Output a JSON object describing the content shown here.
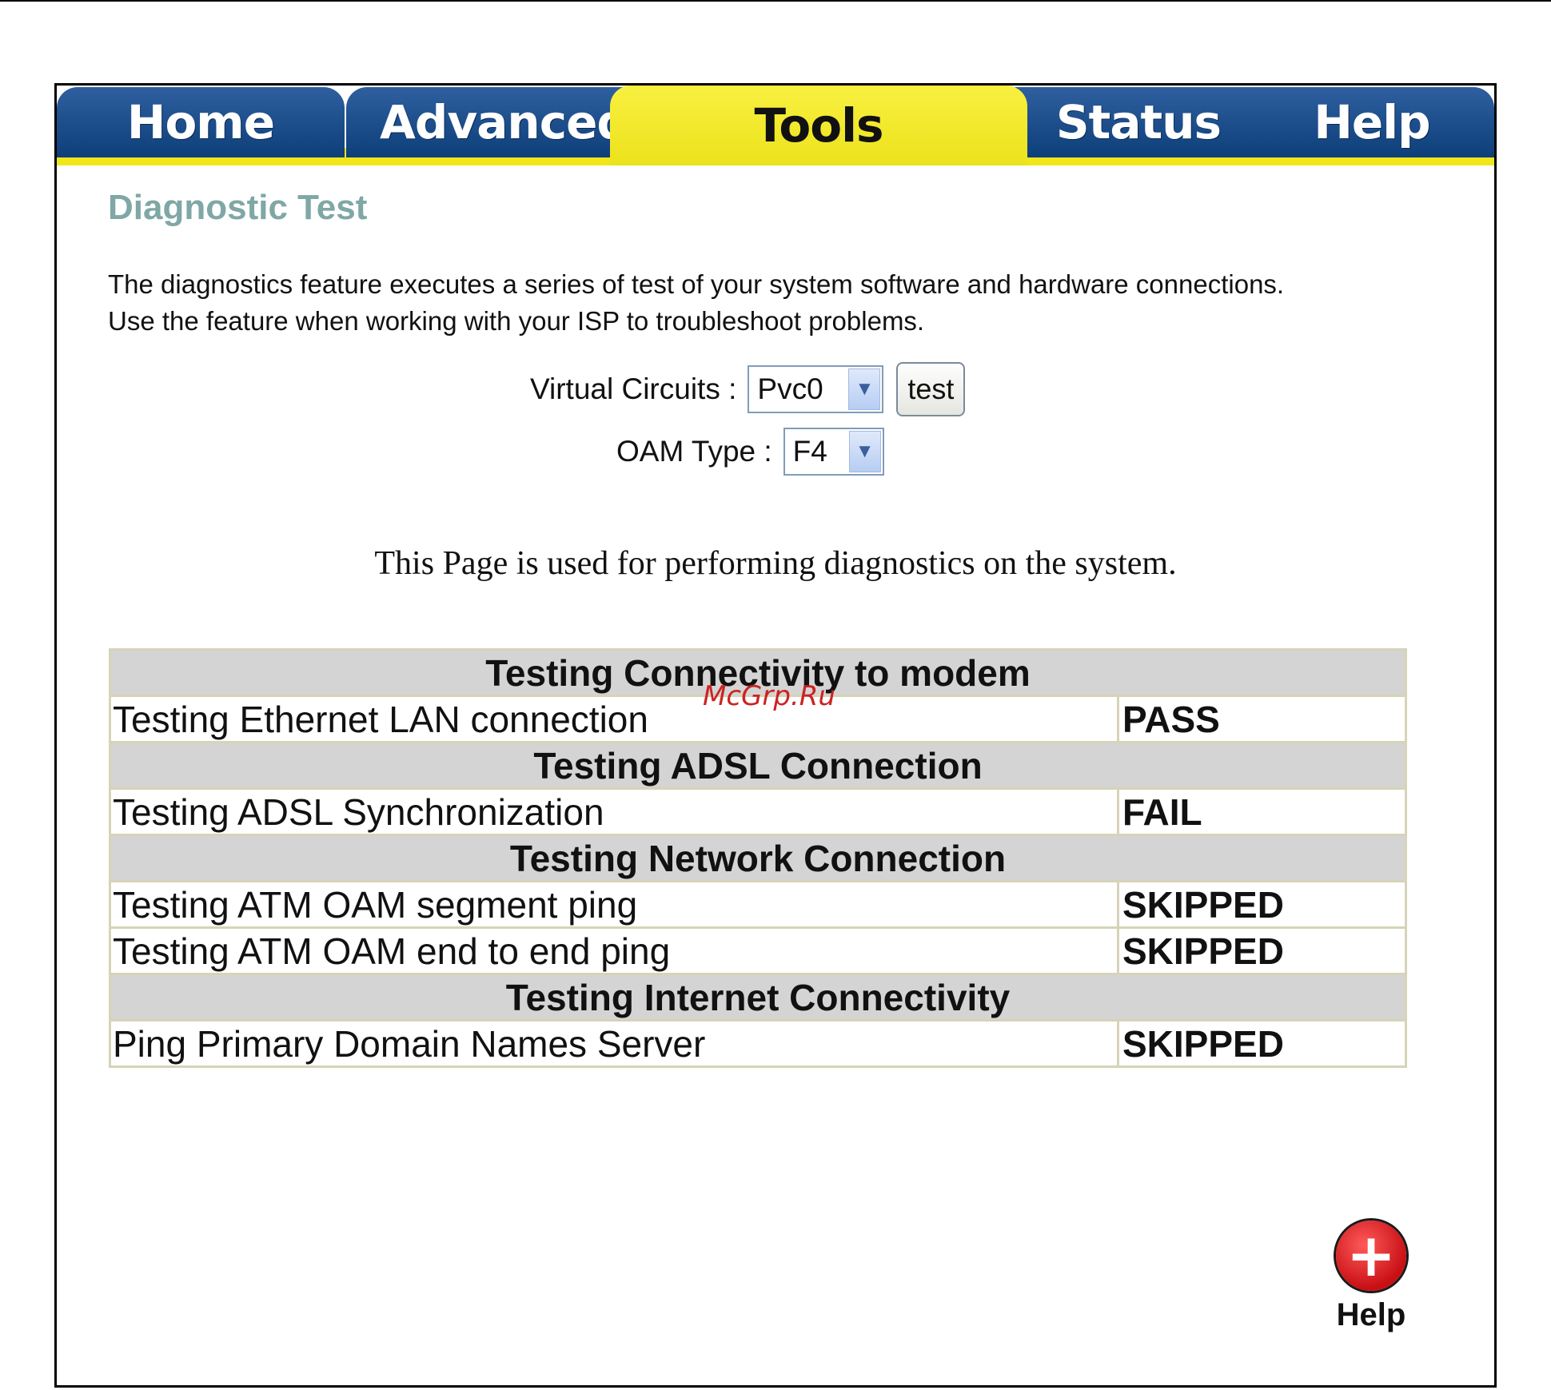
{
  "nav": {
    "tabs": [
      {
        "label": "Home",
        "active": false
      },
      {
        "label": "Advanced",
        "active": false
      },
      {
        "label": "Tools",
        "active": true
      },
      {
        "label": "Status",
        "active": false
      },
      {
        "label": "Help",
        "active": false
      }
    ]
  },
  "page": {
    "title": "Diagnostic Test",
    "description": "The diagnostics feature executes a series of test of your system software and hardware connections. Use the feature when working with your ISP to troubleshoot problems.",
    "info_line": "This Page is used for performing diagnostics on the system."
  },
  "form": {
    "virtual_circuits_label": "Virtual Circuits :",
    "virtual_circuits_value": "Pvc0",
    "test_button_label": "test",
    "oam_type_label": "OAM Type :",
    "oam_type_value": "F4"
  },
  "results": {
    "sections": [
      {
        "title": "Testing Connectivity to modem",
        "tests": [
          {
            "name": "Testing Ethernet LAN connection",
            "status": "PASS"
          }
        ]
      },
      {
        "title": "Testing ADSL Connection",
        "tests": [
          {
            "name": "Testing ADSL Synchronization",
            "status": "FAIL"
          }
        ]
      },
      {
        "title": "Testing Network Connection",
        "tests": [
          {
            "name": "Testing ATM OAM segment ping",
            "status": "SKIPPED"
          },
          {
            "name": "Testing ATM OAM end to end ping",
            "status": "SKIPPED"
          }
        ]
      },
      {
        "title": "Testing Internet Connectivity",
        "tests": [
          {
            "name": "Ping Primary Domain Names Server",
            "status": "SKIPPED"
          }
        ]
      }
    ]
  },
  "watermark": "McGrp.Ru",
  "help_link": {
    "label": "Help",
    "icon": "plus-circle-icon"
  },
  "colors": {
    "tab_blue": "#0d3f7a",
    "tab_active_yellow": "#f0e61a",
    "title_teal": "#7fa7a5",
    "pass_green": "#2e7d32",
    "fail_red": "#e0202a",
    "section_gray": "#d4d4d4"
  }
}
